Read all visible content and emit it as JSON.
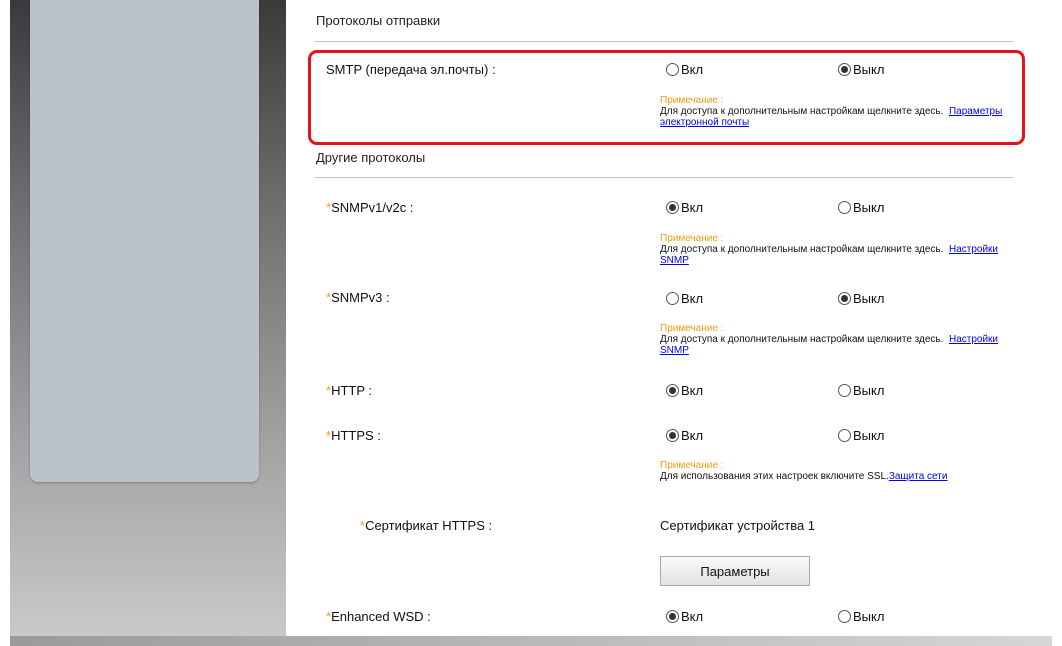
{
  "colors": {
    "highlight": "#e0141a",
    "note": "#f39c12",
    "link": "#0000ee",
    "nav_panel": "#bac2cc"
  },
  "sections": {
    "send": {
      "title": "Протоколы отправки",
      "smtp": {
        "label": "SMTP (передача эл.почты) :",
        "on_label": "Вкл",
        "off_label": "Выкл",
        "selected": "off",
        "note_title": "Примечание :",
        "note_text": "Для доступа к дополнительным настройкам щелкните здесь.",
        "note_link": "Параметры электронной почты"
      }
    },
    "other": {
      "title": "Другие протоколы",
      "snmpv1": {
        "star": "*",
        "label": "SNMPv1/v2c :",
        "on_label": "Вкл",
        "off_label": "Выкл",
        "selected": "on",
        "note_title": "Примечание :",
        "note_text": "Для доступа к дополнительным настройкам щелкните здесь.",
        "note_link": "Настройки SNMP"
      },
      "snmpv3": {
        "star": "*",
        "label": "SNMPv3 :",
        "on_label": "Вкл",
        "off_label": "Выкл",
        "selected": "off",
        "note_title": "Примечание :",
        "note_text": "Для доступа к дополнительным настройкам щелкните здесь.",
        "note_link": "Настройки SNMP"
      },
      "http": {
        "star": "*",
        "label": "HTTP :",
        "on_label": "Вкл",
        "off_label": "Выкл",
        "selected": "on"
      },
      "https": {
        "star": "*",
        "label": "HTTPS :",
        "on_label": "Вкл",
        "off_label": "Выкл",
        "selected": "on",
        "note_title": "Примечание :",
        "note_text": "Для использования этих настроек включите SSL.",
        "note_link": "Защита сети"
      },
      "https_cert": {
        "star": "*",
        "label": "Сертификат HTTPS :",
        "value": "Сертификат устройства 1",
        "button_label": "Параметры"
      },
      "wsd": {
        "star": "*",
        "label": "Enhanced WSD :",
        "on_label": "Вкл",
        "off_label": "Выкл",
        "selected": "on"
      }
    }
  }
}
